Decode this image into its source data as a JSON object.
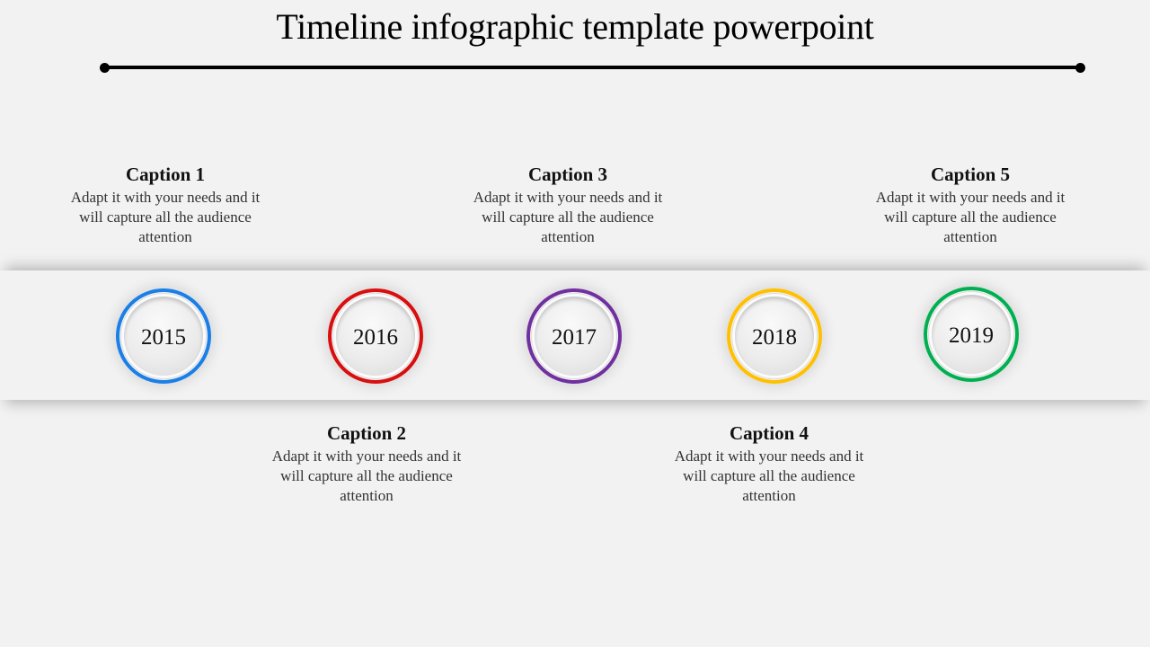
{
  "title": "Timeline infographic template powerpoint",
  "milestones": [
    {
      "year": "2015",
      "color": "#1a7fe6",
      "caption": "Caption 1",
      "text": "Adapt it with your needs and it will capture all the audience attention",
      "position": "above"
    },
    {
      "year": "2016",
      "color": "#d90f0f",
      "caption": "Caption 2",
      "text": "Adapt it with your needs and it will capture all the audience attention",
      "position": "below"
    },
    {
      "year": "2017",
      "color": "#7030a0",
      "caption": "Caption 3",
      "text": "Adapt it with your needs and it will capture all the audience attention",
      "position": "above"
    },
    {
      "year": "2018",
      "color": "#ffc000",
      "caption": "Caption 4",
      "text": "Adapt it with your needs and it will capture all the audience attention",
      "position": "below"
    },
    {
      "year": "2019",
      "color": "#00b050",
      "caption": "Caption 5",
      "text": "Adapt it with your needs and it will capture all the audience attention",
      "position": "above"
    }
  ]
}
